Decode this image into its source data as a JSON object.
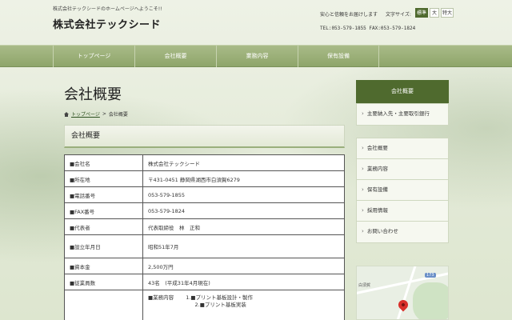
{
  "header": {
    "welcome": "株式会社テックシードのホームページへようこそ!!",
    "site_title": "株式会社テックシード",
    "tagline": "安心と信頼をお届けします",
    "font_size_label": "文字サイズ:",
    "font_sizes": [
      "標準",
      "大",
      "特大"
    ],
    "contact": "TEL:053-579-1855 FAX:053-579-1824"
  },
  "nav": {
    "items": [
      "トップページ",
      "会社概要",
      "業務内容",
      "保有設備"
    ]
  },
  "main": {
    "page_heading": "会社概要",
    "breadcrumb": {
      "home": "トップページ",
      "separator": ">",
      "current": "会社概要"
    },
    "section_heading": "会社概要",
    "table": [
      {
        "key": "■会社名",
        "value": "株式会社テックシード"
      },
      {
        "key": "■所在地",
        "value": "〒431-0451 静岡県湖西市白須賀6279"
      },
      {
        "key": "■電話番号",
        "value": "053-579-1855"
      },
      {
        "key": "■FAX番号",
        "value": "053-579-1824"
      },
      {
        "key": "■代表者",
        "value": "代表取締役　林　正和"
      },
      {
        "key": "■設立年月日",
        "value": "昭和51年7月"
      },
      {
        "key": "■資本金",
        "value": "2,500万円"
      },
      {
        "key": "■従業員数",
        "value": "43名　(平成31年4月現在)"
      }
    ],
    "business": {
      "key": "",
      "line1": "■業務内容　　 1.■プリント基板設計・製作",
      "line2": "　　　　　　　　　2.■プリント基板実装"
    }
  },
  "sidebar": {
    "head": "会社概要",
    "box1": [
      "主要納入先・主要取引銀行"
    ],
    "box2": [
      "会社概要",
      "業務内容",
      "保有設備",
      "採用情報",
      "お問い合わせ"
    ]
  },
  "map": {
    "route_label": "173",
    "place_label": "白須賀"
  }
}
